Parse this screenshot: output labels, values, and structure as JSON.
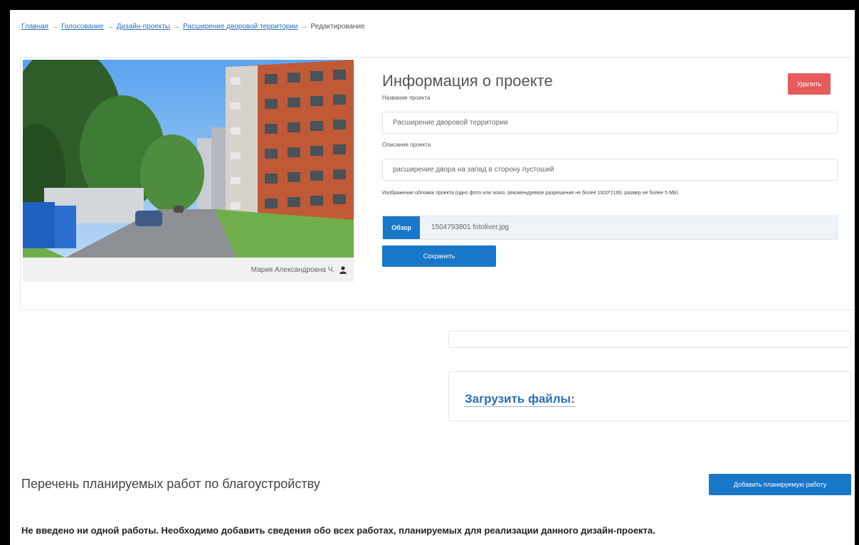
{
  "breadcrumb": {
    "items": [
      "Главная",
      "Голосование",
      "Дизайн-проекты",
      "Расширение дворовой территории"
    ],
    "current": "Редактирование",
    "separator": "→"
  },
  "project": {
    "title": "Информация о проекте",
    "delete_label": "Удалить",
    "name_label": "Название проекта",
    "name_value": "Расширение дворовой территории",
    "desc_label": "Описание проекта",
    "desc_value": "расширение двора на запад в сторону пустоший",
    "image_hint": "Изображение обложки проекта (одно фото или эскиз, рекомендуемое разрешение не более 1920*2160, размер не более 5 МБ)",
    "browse_label": "Обзор",
    "file_name": "1504793801 fotoliver.jpg",
    "save_label": "Сохранить",
    "photo_author": "Мария Александровна Ч."
  },
  "upload": {
    "label": "Загрузить файлы:"
  },
  "works": {
    "title": "Перечень планируемых работ по благоустройству",
    "add_label": "Добавить планируемую работу",
    "empty_message": "Не введено ни одной работы. Необходимо добавить сведения обо всех работах, планируемых для реализации данного дизайн-проекта."
  },
  "colors": {
    "accent": "#1877c9",
    "danger": "#e65c5c",
    "link": "#2a6ebb"
  }
}
